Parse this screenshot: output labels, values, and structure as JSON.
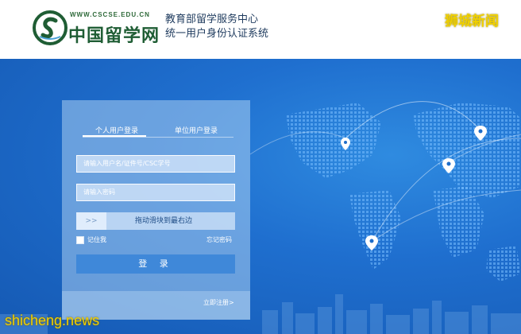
{
  "header": {
    "site_url": "WWW.CSCSE.EDU.CN",
    "site_name": "中国留学网",
    "center_line1": "教育部留学服务中心",
    "center_line2": "统一用户身份认证系统",
    "watermark_top": "狮城新闻"
  },
  "login": {
    "tabs": [
      {
        "label": "个人用户登录",
        "active": true
      },
      {
        "label": "单位用户登录",
        "active": false
      }
    ],
    "username_placeholder": "请输入用户名/证件号/CSC学号",
    "password_placeholder": "请输入密码",
    "slider_handle": ">>",
    "slider_text": "拖动滑块到最右边",
    "remember_label": "记住我",
    "forgot_label": "忘记密码",
    "login_button": "登 录",
    "register_link": "立即注册>"
  },
  "watermark_bottom": "shicheng.news",
  "colors": {
    "background_blue": "#1f6fcf",
    "login_button": "#3f88d9",
    "logo_green": "#1f5d34",
    "watermark_yellow": "#f2d000"
  }
}
